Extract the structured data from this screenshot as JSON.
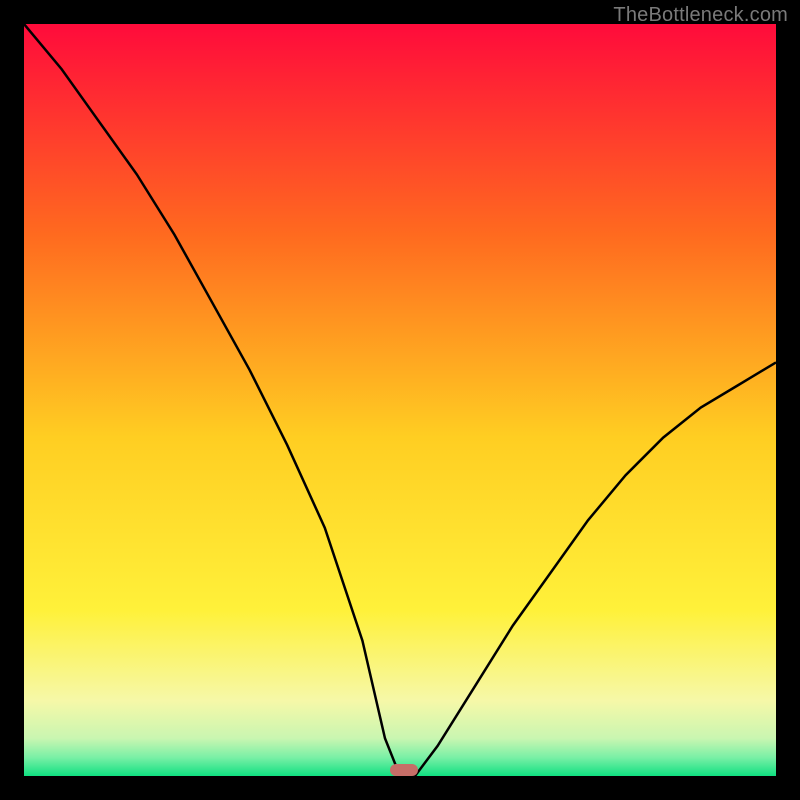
{
  "watermark": "TheBottleneck.com",
  "colors": {
    "top": "#ff0b3b",
    "mid_orange": "#ff8a1a",
    "yellow": "#ffe92e",
    "pale_yellow": "#faf8a3",
    "pale_green": "#c9f6b1",
    "green": "#10e081",
    "curve": "#000000",
    "marker": "#c66e68",
    "frame": "#000000"
  },
  "chart_data": {
    "type": "line",
    "title": "",
    "xlabel": "",
    "ylabel": "",
    "xlim": [
      0,
      1
    ],
    "ylim": [
      0,
      1
    ],
    "notes": "Bottleneck-style V-curve over a vertical red→yellow→green gradient. Minimum (0) near x≈0.5; left arm rises to ≈1 at x=0, right arm rises to ≈0.55 at x=1. A small rounded marker sits near the minimum on the baseline.",
    "series": [
      {
        "name": "bottleneck-curve",
        "x": [
          0.0,
          0.05,
          0.1,
          0.15,
          0.2,
          0.25,
          0.3,
          0.35,
          0.4,
          0.45,
          0.48,
          0.5,
          0.52,
          0.55,
          0.6,
          0.65,
          0.7,
          0.75,
          0.8,
          0.85,
          0.9,
          0.95,
          1.0
        ],
        "y": [
          1.0,
          0.94,
          0.87,
          0.8,
          0.72,
          0.63,
          0.54,
          0.44,
          0.33,
          0.18,
          0.05,
          0.0,
          0.0,
          0.04,
          0.12,
          0.2,
          0.27,
          0.34,
          0.4,
          0.45,
          0.49,
          0.52,
          0.55
        ]
      }
    ],
    "marker": {
      "x": 0.505,
      "y": 0.0
    },
    "gradient_stops": [
      {
        "offset": 0.0,
        "color": "#ff0b3b"
      },
      {
        "offset": 0.28,
        "color": "#ff6a1f"
      },
      {
        "offset": 0.55,
        "color": "#ffce22"
      },
      {
        "offset": 0.78,
        "color": "#fff13a"
      },
      {
        "offset": 0.9,
        "color": "#f6f8a8"
      },
      {
        "offset": 0.95,
        "color": "#c9f6b1"
      },
      {
        "offset": 0.975,
        "color": "#7bf0a6"
      },
      {
        "offset": 1.0,
        "color": "#10e081"
      }
    ]
  }
}
